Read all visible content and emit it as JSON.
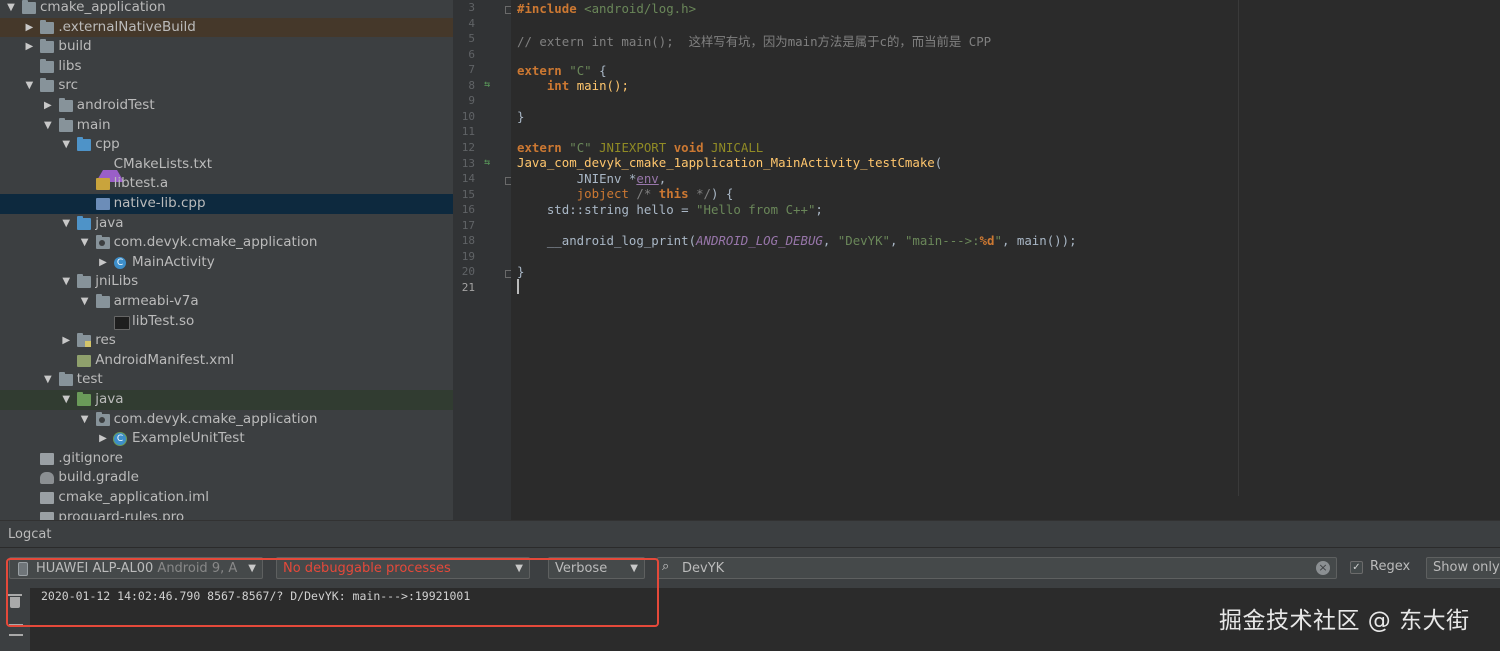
{
  "project_tree": [
    {
      "label": "cmake_application",
      "depth": 0,
      "arrow": "▼",
      "icon": "folder-icon",
      "state": ""
    },
    {
      "label": ".externalNativeBuild",
      "depth": 1,
      "arrow": "▶",
      "icon": "folder-icon",
      "state": "vc"
    },
    {
      "label": "build",
      "depth": 1,
      "arrow": "▶",
      "icon": "folder-icon",
      "state": ""
    },
    {
      "label": "libs",
      "depth": 1,
      "arrow": "",
      "icon": "folder-icon",
      "state": ""
    },
    {
      "label": "src",
      "depth": 1,
      "arrow": "▼",
      "icon": "folder-icon",
      "state": ""
    },
    {
      "label": "androidTest",
      "depth": 2,
      "arrow": "▶",
      "icon": "folder-icon",
      "state": ""
    },
    {
      "label": "main",
      "depth": 2,
      "arrow": "▼",
      "icon": "folder-icon",
      "state": ""
    },
    {
      "label": "cpp",
      "depth": 3,
      "arrow": "▼",
      "icon": "source-folder-icon",
      "state": ""
    },
    {
      "label": "CMakeLists.txt",
      "depth": 4,
      "arrow": "",
      "icon": "cmake-file-icon",
      "state": ""
    },
    {
      "label": "libtest.a",
      "depth": 4,
      "arrow": "",
      "icon": "archive-file-icon",
      "state": ""
    },
    {
      "label": "native-lib.cpp",
      "depth": 4,
      "arrow": "",
      "icon": "cpp-file-icon",
      "state": "selected"
    },
    {
      "label": "java",
      "depth": 3,
      "arrow": "▼",
      "icon": "source-folder-icon",
      "state": ""
    },
    {
      "label": "com.devyk.cmake_application",
      "depth": 4,
      "arrow": "▼",
      "icon": "package-icon",
      "state": ""
    },
    {
      "label": "MainActivity",
      "depth": 5,
      "arrow": "▶",
      "icon": "class-icon",
      "state": ""
    },
    {
      "label": "jniLibs",
      "depth": 3,
      "arrow": "▼",
      "icon": "folder-icon",
      "state": ""
    },
    {
      "label": "armeabi-v7a",
      "depth": 4,
      "arrow": "▼",
      "icon": "folder-icon",
      "state": ""
    },
    {
      "label": "libTest.so",
      "depth": 5,
      "arrow": "",
      "icon": "binary-file-icon",
      "state": ""
    },
    {
      "label": "res",
      "depth": 3,
      "arrow": "▶",
      "icon": "resource-folder-icon",
      "state": ""
    },
    {
      "label": "AndroidManifest.xml",
      "depth": 3,
      "arrow": "",
      "icon": "xml-file-icon",
      "state": ""
    },
    {
      "label": "test",
      "depth": 2,
      "arrow": "▼",
      "icon": "folder-icon",
      "state": ""
    },
    {
      "label": "java",
      "depth": 3,
      "arrow": "▼",
      "icon": "test-folder-icon",
      "state": "test"
    },
    {
      "label": "com.devyk.cmake_application",
      "depth": 4,
      "arrow": "▼",
      "icon": "package-icon",
      "state": ""
    },
    {
      "label": "ExampleUnitTest",
      "depth": 5,
      "arrow": "▶",
      "icon": "test-class-icon",
      "state": ""
    },
    {
      "label": ".gitignore",
      "depth": 1,
      "arrow": "",
      "icon": "file-icon",
      "state": ""
    },
    {
      "label": "build.gradle",
      "depth": 1,
      "arrow": "",
      "icon": "gradle-icon",
      "state": ""
    },
    {
      "label": "cmake_application.iml",
      "depth": 1,
      "arrow": "",
      "icon": "file-icon",
      "state": ""
    },
    {
      "label": "proguard-rules.pro",
      "depth": 1,
      "arrow": "",
      "icon": "file-icon",
      "state": ""
    }
  ],
  "editor": {
    "line_numbers": [
      "3",
      "4",
      "5",
      "6",
      "7",
      "8",
      "9",
      "10",
      "11",
      "12",
      "13",
      "14",
      "15",
      "16",
      "17",
      "18",
      "19",
      "20",
      "21"
    ],
    "current_line": "21",
    "code": {
      "l3_include": "#include ",
      "l3_header": "<android/log.h>",
      "l5_comment": "// extern int main();  这样写有坑，因为main方法是属于c的，而当前是 CPP",
      "l7_kw": "extern",
      "l7_str": "\"C\"",
      "l7_rest": " {",
      "l8_kw": "int",
      "l8_rest": " main();",
      "l10_text": "}",
      "l12_kw": "extern",
      "l12_str": "\"C\"",
      "l12_macro": "JNIEXPORT",
      "l12_kw2": "void",
      "l12_macro2": "JNICALL",
      "l13_fn": "Java_com_devyk_cmake_1application_MainActivity_testCmake",
      "l13_rest": "(",
      "l14_type": "JNIEnv *",
      "l14_param": "env",
      "l14_rest": ",",
      "l15_type": "jobject",
      "l15_cmt_open": "/* ",
      "l15_this": "this",
      "l15_cmt_close": " */",
      "l15_rest": ") {",
      "l16_a": "std::string hello = ",
      "l16_str": "\"Hello from C++\"",
      "l16_rest": ";",
      "l18_a": "__android_log_print(",
      "l18_const": "ANDROID_LOG_DEBUG",
      "l18_b": ", ",
      "l18_str1": "\"DevYK\"",
      "l18_c": ", ",
      "l18_str2": "\"main--->:",
      "l18_fmt": "%d",
      "l18_str2b": "\"",
      "l18_d": ", main());",
      "l20_text": "}"
    }
  },
  "logcat": {
    "title": "Logcat",
    "device": "HUAWEI ALP-AL00",
    "device_os": "Android 9, A",
    "process": "No debuggable processes",
    "level": "Verbose",
    "search_value": "DevYK",
    "regex_label": "Regex",
    "regex_checked": "✓",
    "show_only_label": "Show only",
    "log_line": "2020-01-12 14:02:46.790 8567-8567/? D/DevYK: main--->:19921001"
  },
  "watermark": "掘金技术社区 @ 东大街",
  "colors": {
    "annotation_box": "#e5493a",
    "selection": "#0d293e",
    "keyword": "#cc7832",
    "string": "#6a8759",
    "function": "#ffc66d",
    "process_error": "#e5493a"
  }
}
